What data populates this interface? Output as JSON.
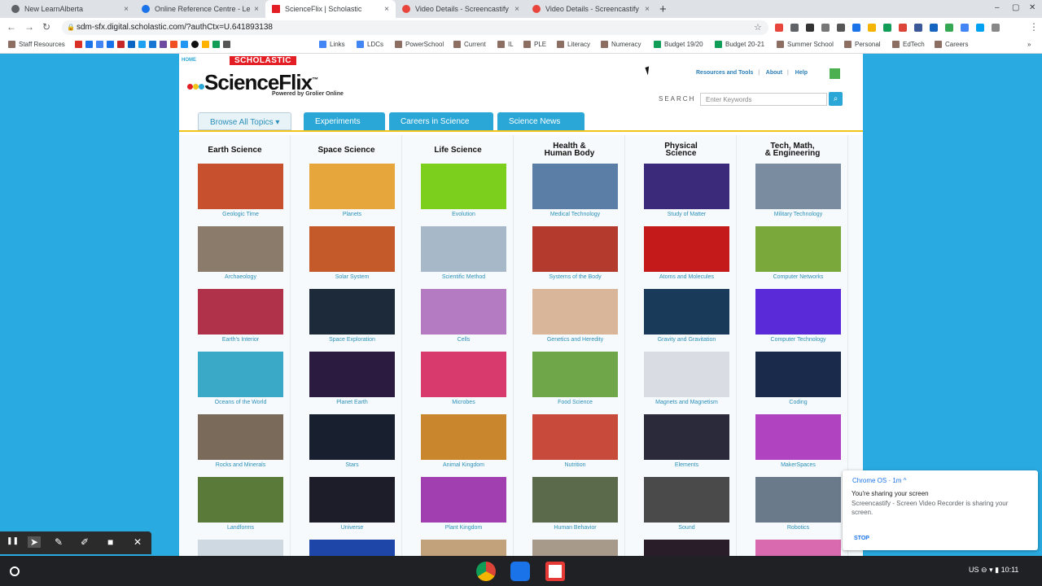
{
  "tabs": [
    {
      "label": "New LearnAlberta",
      "color": "#5f6368"
    },
    {
      "label": "Online Reference Centre - LearnA",
      "color": "#1a73e8"
    },
    {
      "label": "ScienceFlix | Scholastic",
      "color": "#e31e24"
    },
    {
      "label": "Video Details - Screencastify",
      "color": "#e8453c"
    },
    {
      "label": "Video Details - Screencastify",
      "color": "#e8453c"
    }
  ],
  "tab_close": "×",
  "new_tab": "+",
  "window_controls": {
    "minimize": "–",
    "maximize": "▢",
    "close": "✕"
  },
  "nav": {
    "back": "←",
    "forward": "→",
    "reload": "↻"
  },
  "url": "sdm-sfx.digital.scholastic.com/?authCtx=U.641893138",
  "star": "☆",
  "menu_dots": "⋮",
  "extension_colors": [
    "#e8453c",
    "#5f6368",
    "#333",
    "#777",
    "#555",
    "#1a73e8",
    "#f4b400",
    "#0f9d58",
    "#db4437",
    "#3b5998",
    "#1565c0",
    "#34a853",
    "#4285f4",
    "#00a1f1",
    "#888"
  ],
  "bookmarks": [
    {
      "label": "Staff Resources",
      "color": "#8d6e63"
    },
    {
      "label": "Links",
      "color": "#4285f4"
    },
    {
      "label": "LDCs",
      "color": "#4285f4"
    },
    {
      "label": "PowerSchool",
      "color": "#8d6e63"
    },
    {
      "label": "Current",
      "color": "#8d6e63"
    },
    {
      "label": "IL",
      "color": "#8d6e63"
    },
    {
      "label": "PLE",
      "color": "#8d6e63"
    },
    {
      "label": "Literacy",
      "color": "#8d6e63"
    },
    {
      "label": "Numeracy",
      "color": "#8d6e63"
    },
    {
      "label": "Budget 19/20",
      "color": "#0f9d58"
    },
    {
      "label": "Budget 20-21",
      "color": "#0f9d58"
    },
    {
      "label": "Summer School",
      "color": "#8d6e63"
    },
    {
      "label": "Personal",
      "color": "#8d6e63"
    },
    {
      "label": "EdTech",
      "color": "#8d6e63"
    },
    {
      "label": "Careers",
      "color": "#8d6e63"
    }
  ],
  "bookmark_overflow": "»",
  "site": {
    "home": "HOME",
    "brand": "SCHOLASTIC",
    "logo": "ScienceFlix",
    "trademark": "™",
    "powered": "Powered by Grolier Online",
    "links": [
      "Resources and Tools",
      "About",
      "Help"
    ],
    "link_separator": "|",
    "search_label": "SEARCH",
    "search_placeholder": "Enter Keywords",
    "search_glyph": "⌕",
    "menu": [
      "Browse All Topics",
      "Experiments",
      "Careers in Science",
      "Science News"
    ],
    "menu_caret": "▾"
  },
  "columns": [
    {
      "title": [
        "Earth Science"
      ],
      "items": [
        "Geologic Time",
        "Archaeology",
        "Earth's Interior",
        "Oceans of the World",
        "Rocks and Minerals",
        "Landforms"
      ],
      "colors": [
        "#c7502f",
        "#8a7b6a",
        "#b0324a",
        "#3aa9c8",
        "#7a6a5a",
        "#5a7a3a",
        "#cfd9e2"
      ]
    },
    {
      "title": [
        "Space Science"
      ],
      "items": [
        "Planets",
        "Solar System",
        "Space Exploration",
        "Planet Earth",
        "Stars",
        "Universe"
      ],
      "colors": [
        "#e7a63b",
        "#c45a2a",
        "#1d2a3a",
        "#2b1b40",
        "#182030",
        "#1d1d2a",
        "#1d46a8"
      ]
    },
    {
      "title": [
        "Life Science"
      ],
      "items": [
        "Evolution",
        "Scientific Method",
        "Cells",
        "Microbes",
        "Animal Kingdom",
        "Plant Kingdom"
      ],
      "colors": [
        "#7ccf1d",
        "#a7b9c9",
        "#b57bc2",
        "#d83a6e",
        "#c9862c",
        "#a13fb0",
        "#c2a27a"
      ]
    },
    {
      "title": [
        "Health &",
        "Human Body"
      ],
      "items": [
        "Medical Technology",
        "Systems of the Body",
        "Genetics and Heredity",
        "Food Science",
        "Nutrition",
        "Human Behavior"
      ],
      "colors": [
        "#5a7ea6",
        "#b33a2c",
        "#d9b59a",
        "#6fa64a",
        "#c74a3a",
        "#5a6a4a",
        "#a89a8a"
      ]
    },
    {
      "title": [
        "Physical",
        "Science"
      ],
      "items": [
        "Study of Matter",
        "Atoms and Molecules",
        "Gravity and Gravitation",
        "Magnets and Magnetism",
        "Elements",
        "Sound"
      ],
      "colors": [
        "#3b2a7a",
        "#c41a1a",
        "#1a3a5a",
        "#d9dde3",
        "#2a2a3a",
        "#4a4a4a",
        "#2a1d2a"
      ]
    },
    {
      "title": [
        "Tech, Math,",
        "& Engineering"
      ],
      "items": [
        "Military Technology",
        "Computer Networks",
        "Computer Technology",
        "Coding",
        "MakerSpaces",
        "Robotics"
      ],
      "colors": [
        "#7a8ca0",
        "#7aa83a",
        "#5a2ad8",
        "#1a2a4a",
        "#b044c0",
        "#6a7a8a",
        "#d96ab0"
      ]
    }
  ],
  "notification": {
    "header": "Chrome OS · 1m ^",
    "title": "You're sharing your screen",
    "body": "Screencastify - Screen Video Recorder is sharing your screen.",
    "action": "STOP"
  },
  "recorder_tools": [
    "❚❚",
    "➤",
    "✎",
    "✐",
    "■",
    "✕"
  ],
  "shelf": {
    "apps": [
      {
        "name": "chrome",
        "color": "#4caf50"
      },
      {
        "name": "files",
        "color": "#1a73e8"
      },
      {
        "name": "gmail",
        "color": "#e53935"
      }
    ],
    "tray_locale": "US",
    "tray_time": "10:11",
    "tray_icons": "⊖ ▾ ▮"
  }
}
